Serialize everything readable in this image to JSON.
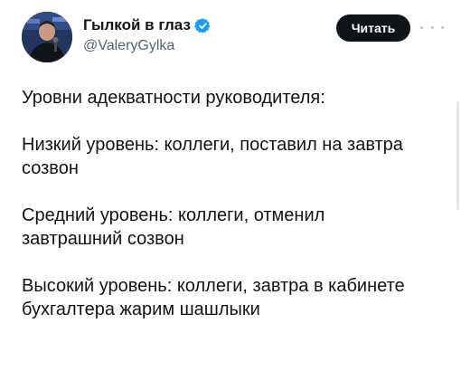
{
  "author": {
    "display_name": "Гылкой в глаз",
    "handle": "@ValeryGylka",
    "verified": true,
    "avatar": "profile-photo"
  },
  "actions": {
    "follow_label": "Читать",
    "more_icon": "ellipsis-icon"
  },
  "tweet": {
    "paragraphs": [
      [
        "Уровни адекватности руководителя:"
      ],
      [
        "Низкий уровень: коллеги, поставил на завтра",
        "созвон"
      ],
      [
        "Средний уровень: коллеги, отменил",
        "завтрашний созвон"
      ],
      [
        "Высокий уровень: коллеги, завтра в кабинете",
        "бухгалтера жарим шашлыки"
      ]
    ]
  },
  "colors": {
    "verified_badge": "#1d9bf0",
    "follow_bg": "#0f1419",
    "text": "#0f1419",
    "secondary_text": "#536471"
  }
}
